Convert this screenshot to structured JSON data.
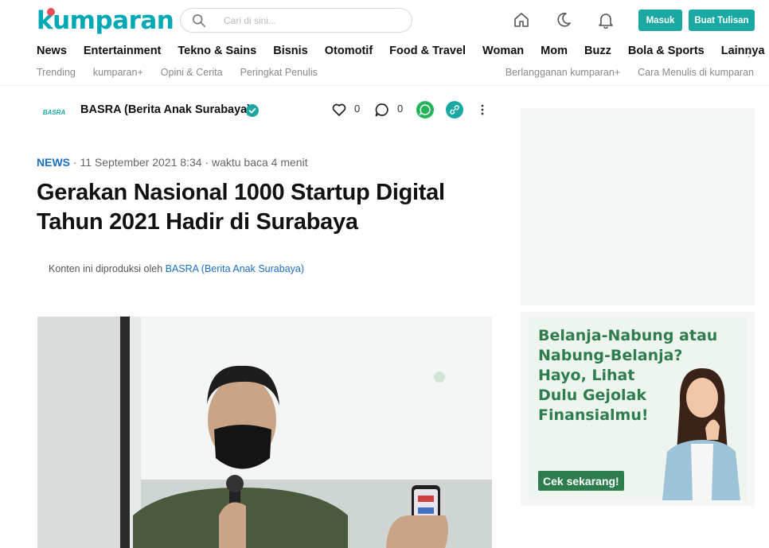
{
  "header": {
    "logo_text": "kumparan",
    "search_placeholder": "Cari di sini...",
    "login_label": "Masuk",
    "write_label": "Buat Tulisan",
    "icons": [
      "home-icon",
      "moon-icon",
      "bell-icon"
    ]
  },
  "nav": {
    "items": [
      "News",
      "Entertainment",
      "Tekno & Sains",
      "Bisnis",
      "Otomotif",
      "Food & Travel",
      "Woman",
      "Mom",
      "Buzz",
      "Bola & Sports",
      "Lainnya"
    ],
    "more_glyph": "⋮"
  },
  "subnav": {
    "left": [
      "Trending",
      "kumparan+",
      "Opini & Cerita",
      "Peringkat Penulis"
    ],
    "right": [
      "Berlangganan kumparan+",
      "Cara Menulis di kumparan"
    ]
  },
  "publisher": {
    "logo_text": "BASRA",
    "name": "BASRA (Berita Anak Surabaya)",
    "like_count": "0",
    "comment_count": "0"
  },
  "article": {
    "category": "NEWS",
    "meta": " · 11 September 2021 8:34 · waktu baca 4 menit",
    "title": "Gerakan Nasional 1000 Startup Digital Tahun 2021 Hadir di Surabaya",
    "produced_prefix": "Konten ini diproduksi oleh ",
    "produced_source": "BASRA (Berita Anak Surabaya)"
  },
  "sidebar_ad": {
    "text": "Belanja-Nabung atau\nNabung-Belanja?\nHayo, Lihat\nDulu Gejolak\nFinansialmu!",
    "cta": "Cek sekarang!"
  },
  "colors": {
    "brand": "#00a8b5",
    "button": "#1aa8a3",
    "link": "#1a6fbf",
    "ad_green": "#2e7d4f",
    "whatsapp": "#25b35b"
  }
}
